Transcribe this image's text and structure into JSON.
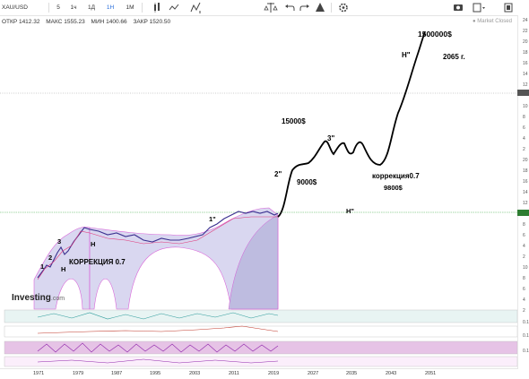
{
  "toolbar": {
    "symbol": "XAU/USD",
    "intervals": [
      "5",
      "1ч",
      "1Д",
      "1Н",
      "1М"
    ],
    "active_interval": "1Н",
    "icons": [
      "candles-icon",
      "indicators-icon",
      "draw-icon",
      "compare-icon",
      "undo-icon",
      "redo-icon",
      "alert-icon",
      "settings-icon",
      "camera-icon",
      "layout-icon",
      "fullscreen-icon"
    ]
  },
  "info": {
    "open": "ОТКР 1412.32",
    "high": "МАКС 1555.23",
    "low": "МИН 1400.66",
    "close": "ЗАКР 1520.50",
    "market_status": "Market Closed"
  },
  "annotations": {
    "top_target": "1500000$",
    "year": "2065 г.",
    "target_15000": "15000$",
    "target_9000": "9000$",
    "wave_3": "3\"",
    "wave_2": "2\"",
    "wave_H_top": "H\"",
    "wave_H_mid": "H\"",
    "correction": "коррекция0.7",
    "target_9800": "9800$",
    "wave_1": "1\"",
    "wave_3_low": "3",
    "wave_2_low": "2",
    "wave_1_low": "1",
    "wave_H1": "H",
    "wave_H2": "H",
    "correction_upper": "КОРРЕКЦИЯ 0.7"
  },
  "logo": {
    "brand": "Investing",
    "suffix": ".com"
  },
  "price_axis": [
    "24",
    "22",
    "20",
    "18",
    "16",
    "14",
    "12",
    "10",
    "8",
    "6",
    "4",
    "2",
    "20",
    "18",
    "16",
    "14",
    "12",
    "10",
    "8",
    "6",
    "4",
    "2",
    "10",
    "8",
    "6",
    "4",
    "2",
    "0.1",
    "0.1",
    "0.1"
  ],
  "x_axis": [
    "1971",
    "1979",
    "1987",
    "1995",
    "2003",
    "2011",
    "2019",
    "2027",
    "2035",
    "2043",
    "2051"
  ],
  "colors": {
    "accent": "#2a6fdb",
    "price_line": "#2e7d32",
    "band_fill": "#c9c7ec",
    "band_edge": "#d24bd2"
  }
}
